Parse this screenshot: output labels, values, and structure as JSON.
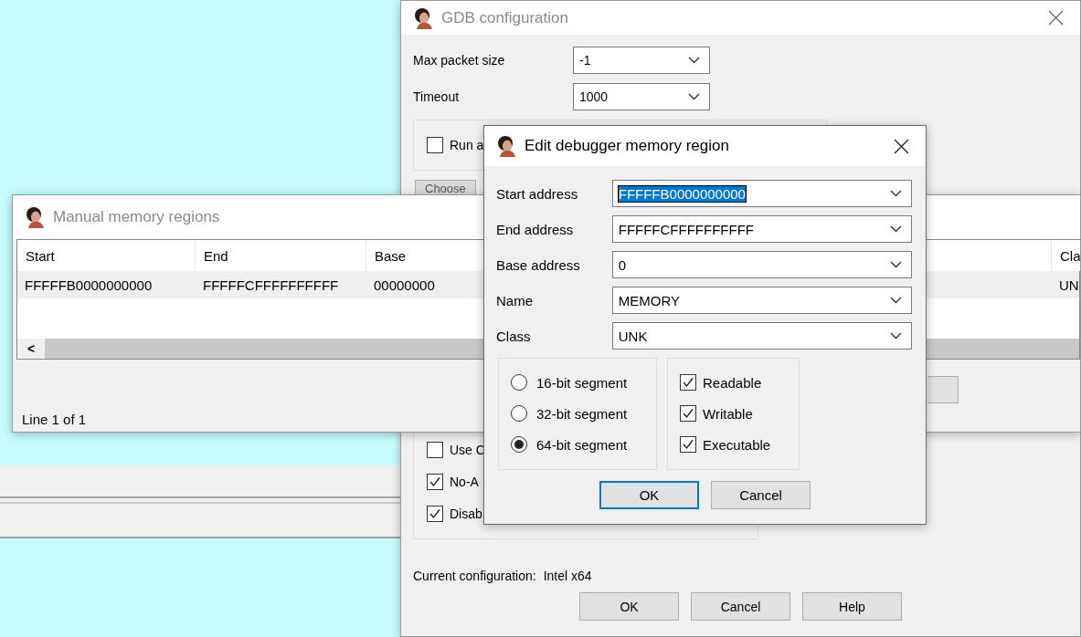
{
  "gdb_window": {
    "title": "GDB configuration",
    "active": false,
    "fields": [
      {
        "label": "Max packet size",
        "value": "-1"
      },
      {
        "label": "Timeout",
        "value": "1000"
      }
    ],
    "run_option": {
      "label": "Run a",
      "checked": false
    },
    "choose_button": "Choose",
    "options": [
      {
        "label": "Use C",
        "checked": false
      },
      {
        "label": "No-A",
        "checked": true
      },
      {
        "label": "Disab",
        "checked": true
      }
    ],
    "current_configuration": {
      "label": "Current configuration:",
      "value": "Intel x64"
    },
    "buttons": [
      {
        "label": "OK"
      },
      {
        "label": "Cancel"
      },
      {
        "label": "Help"
      }
    ]
  },
  "manual_window": {
    "title": "Manual memory regions",
    "active": false,
    "columns": [
      "Start",
      "End",
      "Base",
      "Cla"
    ],
    "rows": [
      {
        "cells": [
          "FFFFFB0000000000",
          "FFFFFCFFFFFFFFFF",
          "00000000",
          "UN"
        ]
      }
    ],
    "scroll_button": "<",
    "status": "Line 1 of 1"
  },
  "edit_dialog": {
    "title": "Edit debugger memory region",
    "active": true,
    "fields": [
      {
        "label": "Start address",
        "value": "FFFFFB0000000000",
        "text_selected": true
      },
      {
        "label": "End address",
        "value": "FFFFFCFFFFFFFFFF",
        "text_selected": false
      },
      {
        "label": "Base address",
        "value": "0",
        "text_selected": false
      },
      {
        "label": "Name",
        "value": "MEMORY",
        "text_selected": false
      },
      {
        "label": "Class",
        "value": "UNK",
        "text_selected": false
      }
    ],
    "segments": [
      {
        "label": "16-bit segment",
        "selected": false
      },
      {
        "label": "32-bit segment",
        "selected": false
      },
      {
        "label": "64-bit segment",
        "selected": true
      }
    ],
    "permissions": [
      {
        "label": "Readable",
        "checked": true
      },
      {
        "label": "Writable",
        "checked": true
      },
      {
        "label": "Executable",
        "checked": true
      }
    ],
    "buttons": [
      {
        "label": "OK",
        "default": true
      },
      {
        "label": "Cancel",
        "default": false
      }
    ]
  }
}
